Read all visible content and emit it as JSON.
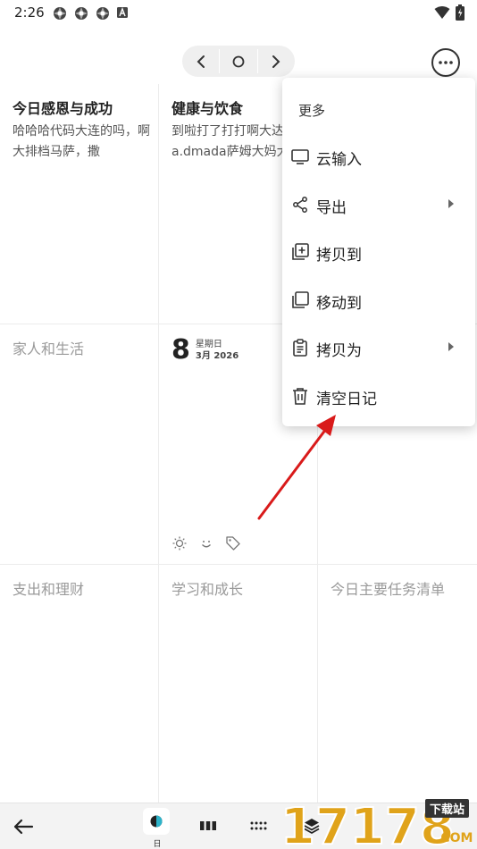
{
  "status": {
    "time": "2:26",
    "icons": [
      "settings-gear-icon",
      "settings-gear-icon",
      "settings-gear-icon",
      "a-letter-icon"
    ],
    "right_icons": [
      "wifi-icon",
      "battery-icon"
    ]
  },
  "nav": {
    "prev": "chevron-left-icon",
    "today": "circle-icon",
    "next": "chevron-right-icon",
    "more": "more-horizontal-icon"
  },
  "cells": {
    "c1": {
      "title": "今日感恩与成功",
      "body": "哈哈哈代码大连的吗，啊大排档马萨，撒"
    },
    "c2": {
      "title": "健康与饮食",
      "body": "到啦打了打打啊大达sasa.dmada萨姆大妈大叔"
    },
    "c4": {
      "title": "家人和生活"
    },
    "c5": {
      "day": "8",
      "weekday": "星期日",
      "month": "3月 2026"
    },
    "c7": {
      "title": "支出和理财"
    },
    "c8": {
      "title": "学习和成长"
    },
    "c9": {
      "title": "今日主要任务清单"
    }
  },
  "menu": {
    "header": "更多",
    "items": [
      {
        "label": "云输入",
        "icon": "monitor-icon",
        "submenu": false
      },
      {
        "label": "导出",
        "icon": "share-icon",
        "submenu": true
      },
      {
        "label": "拷贝到",
        "icon": "copy-plus-icon",
        "submenu": false
      },
      {
        "label": "移动到",
        "icon": "move-copy-icon",
        "submenu": false
      },
      {
        "label": "拷贝为",
        "icon": "clipboard-icon",
        "submenu": true
      },
      {
        "label": "清空日记",
        "icon": "trash-icon",
        "submenu": false
      }
    ]
  },
  "bottom": {
    "day_label": "日",
    "watermark_brand": "17178",
    "watermark_tag": "下载站",
    "watermark_suffix": ".COM"
  },
  "colors": {
    "accent_arrow": "#d91a1a",
    "menu_bg": "#ffffff",
    "dim_text": "#9a9a9a",
    "watermark_gold": "#e0a31a"
  }
}
